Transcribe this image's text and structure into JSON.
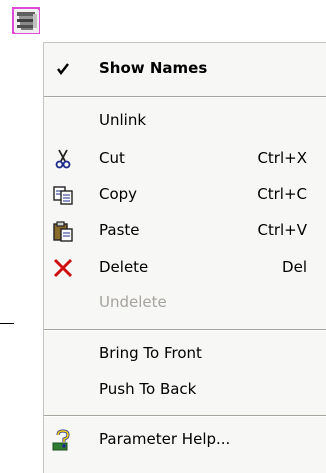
{
  "menu": {
    "show_names": "Show Names",
    "unlink": "Unlink",
    "cut": "Cut",
    "cut_shortcut": "Ctrl+X",
    "copy": "Copy",
    "copy_shortcut": "Ctrl+C",
    "paste": "Paste",
    "paste_shortcut": "Ctrl+V",
    "delete": "Delete",
    "delete_shortcut": "Del",
    "undelete": "Undelete",
    "bring_to_front": "Bring To Front",
    "push_to_back": "Push To Back",
    "parameter_help": "Parameter Help..."
  },
  "icons": {
    "node": "node-icon",
    "check": "check-icon",
    "cut": "scissors-icon",
    "copy": "copy-icon",
    "paste": "paste-icon",
    "delete": "delete-x-icon",
    "help": "help-icon"
  },
  "colors": {
    "selection_border": "#e04ad6",
    "menu_bg": "#f7f7f6",
    "delete_red": "#d01010",
    "disabled_text": "#a6a39e"
  },
  "state": {
    "show_names_checked": true,
    "undelete_enabled": false
  }
}
